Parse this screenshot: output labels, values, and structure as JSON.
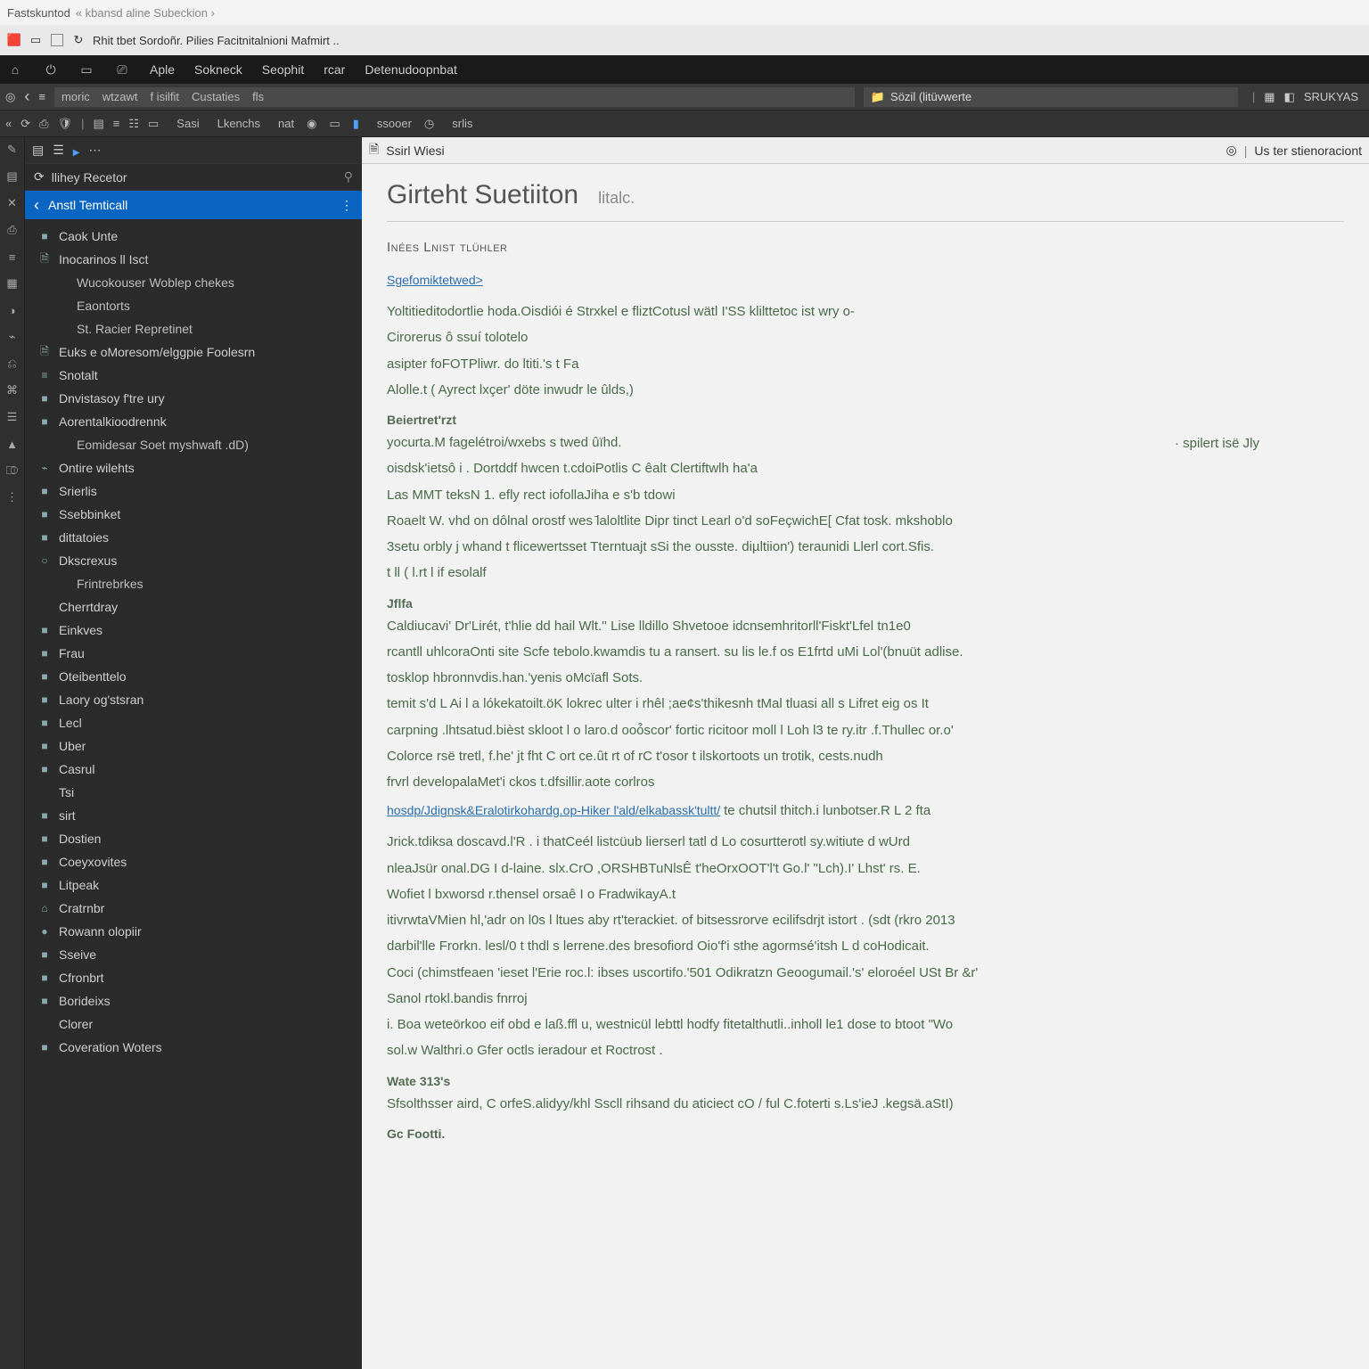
{
  "window": {
    "title_left": "Fastskuntod",
    "title_right": "« kbansd aline Subeckion ›"
  },
  "browser": {
    "tab_title": "Rhit tbet   Sordoñr. Pilies Facitnitalnioni Mafmirt  .."
  },
  "menubar": {
    "items": [
      "Aple",
      "Sokneck",
      "Seophit",
      "rcar",
      "Detenudoopnbat"
    ]
  },
  "addressbar": {
    "chips": [
      "moric",
      "wtzawt",
      "f isilfit",
      "Custaties",
      "fls"
    ],
    "search_text": "Sözil (litüvwerte",
    "right_label": "SRUKYAS"
  },
  "toolbar2": {
    "labels": [
      "Sasi",
      "Lkenchs",
      "nat",
      "ssooer",
      "srlis"
    ]
  },
  "sidebar": {
    "header_label": "llihey Recetor",
    "selected": "Anstl Temticall",
    "items": [
      {
        "label": "Caok Unte",
        "icon": "■",
        "cls": ""
      },
      {
        "label": "Inocarinos ll Isct",
        "icon": "🗎",
        "cls": ""
      },
      {
        "label": "Wucokouser Woblep chekes",
        "icon": "",
        "cls": "sub"
      },
      {
        "label": "Eaontorts",
        "icon": "",
        "cls": "sub"
      },
      {
        "label": "St. Racier Repretinet",
        "icon": "",
        "cls": "sub"
      },
      {
        "label": "Euks e oMoresom/elggpie Foolesrn",
        "icon": "🗎",
        "cls": ""
      },
      {
        "label": "Snotalt",
        "icon": "≡",
        "cls": ""
      },
      {
        "label": "Dnvistasoy f'tre ury",
        "icon": "■",
        "cls": ""
      },
      {
        "label": "Aorentalkioodrennk",
        "icon": "■",
        "cls": ""
      },
      {
        "label": "Eomidesar Soet myshwaft .dD)",
        "icon": "",
        "cls": "sub"
      },
      {
        "label": "Ontire wilehts",
        "icon": "⌁",
        "cls": ""
      },
      {
        "label": "Srierlis",
        "icon": "■",
        "cls": ""
      },
      {
        "label": "Ssebbinket",
        "icon": "■",
        "cls": ""
      },
      {
        "label": "dittatoies",
        "icon": "■",
        "cls": ""
      },
      {
        "label": "Dkscrexus",
        "icon": "○",
        "cls": ""
      },
      {
        "label": "Frintrebrkes",
        "icon": "",
        "cls": "sub"
      },
      {
        "label": "Cherrtdray",
        "icon": "",
        "cls": ""
      },
      {
        "label": "Einkves",
        "icon": "■",
        "cls": ""
      },
      {
        "label": "Frau",
        "icon": "■",
        "cls": ""
      },
      {
        "label": "Oteibenttelo",
        "icon": "■",
        "cls": ""
      },
      {
        "label": "Laory og'stsran",
        "icon": "■",
        "cls": ""
      },
      {
        "label": "Lecl",
        "icon": "■",
        "cls": ""
      },
      {
        "label": "Uber",
        "icon": "■",
        "cls": ""
      },
      {
        "label": "Casrul",
        "icon": "■",
        "cls": ""
      },
      {
        "label": "Tsi",
        "icon": "",
        "cls": ""
      },
      {
        "label": "sirt",
        "icon": "■",
        "cls": ""
      },
      {
        "label": "Dostien",
        "icon": "■",
        "cls": ""
      },
      {
        "label": "Coeyxovites",
        "icon": "■",
        "cls": ""
      },
      {
        "label": "Litpeak",
        "icon": "■",
        "cls": ""
      },
      {
        "label": "Cratrnbr",
        "icon": "⌂",
        "cls": ""
      },
      {
        "label": "Rowann olopiir",
        "icon": "●",
        "cls": ""
      },
      {
        "label": "Sseive",
        "icon": "■",
        "cls": ""
      },
      {
        "label": "Cfronbrt",
        "icon": "■",
        "cls": ""
      },
      {
        "label": "Borideixs",
        "icon": "■",
        "cls": ""
      },
      {
        "label": "Clorer",
        "icon": "",
        "cls": ""
      },
      {
        "label": "Coveration Woters",
        "icon": "■",
        "cls": ""
      }
    ]
  },
  "doc": {
    "tab_label": "Ssirl Wiesi",
    "tab_right": "Us ter stienoraciont",
    "title": "Girteht Suetiiton",
    "title_sub": "litalc.",
    "h3_1": "Inées Lnist tlühler",
    "link1": "Sgefomiktetwed>",
    "p1": "Yoltitieditodortlie hoda.Oisdiói é Strxkel e fliztCotusl wätl I'SS klilttetoc ist wry o-",
    "p2": "Cirorerus ô ssuí tolotelo",
    "p3": "asipter foFOTPliwr.  do ltiti.'s t Fa",
    "p4": "Alolle.t ( Ayrect lxçer' döte inwudr le ûlds,)",
    "h4_1": "Beiertret'rzt",
    "side": "· spilert isë Jly",
    "p5": "yocurta.M  fagelétroi/wxebs s twed ûïhd.",
    "p6": "oisdsk'ietsô i .  Dortddf hwcen t.cdoiPotlis C êalt Clertiftwlh ha'a",
    "p7": "Las MMT teksN 1. efly rect iofollaJiha e s'b tdowi",
    "p8": "Roaelt W.         vhd on dôlnal orostf wes ̄laloltlite Dipr tinct Learl o'd soFeçwichE[ Cfat  tosk. mkshoblo",
    "p9": "3setu orbly j whand t flicewertsset Tterntuajt sSi the ousste. diµltiion') teraunidi Llerl cort.Sfis.",
    "p10": "t ll ( l.rt l  if esolalf",
    "h4_2": "Jflfa",
    "p11": "Caldiucavi' Dr'Lirét, t'hlie  dd hail Wlt.'' Lise lldillo Shvetooe idcnsemhritorll'Fiskt'Lfel tn1e0",
    "p12": "rcantll uhlcoraOnti site Scfe tebolo.kwamdis tu a ransert.  su lis le.f os E1frtd uMi Lol'(bnuüt adlise.",
    "p13": "tosklop hbronnvdis.han.'yenis oMcïafl  Sots.",
    "p14": "temit s'd L Ai l a lókekatoilt.öK lokrec ulter i rhêl ;ae¢s'thikesnh tMal tluasi all s Lifret eig os It",
    "p15": "carpning .lhtsatud.bièst skloot l o laro.d ooó̂scor' fortic ricitoor moll l  Loh l3 te ry.itr .f.Thullec or.o'",
    "p16": "Colorce rsë tretl, f.he' jt fht C ort ce.ût rt of rC t'osor t ilskortoots un trotik, cests.nudh",
    "p17": "frvrl developalaMet'i ckos t.dfsillir.aote corlros",
    "link2": "hosdp/Jdignsk&Eralotirkohardg.op-Hiker l'ald/elkabassk'tultt/",
    "p18": "te chutsil thitch.i lunbotser.R L 2 fta",
    "p19": "Jrick.tdiksa doscavd.l'R .  i thatCeél listcüub lierserl tatl d Lo cosurtterotl sy.witiute d wUrd",
    "p20": "nleaJsür onal.DG I d-laine.   slx.CrO   ,ORSHBTuNlsÊ t'heOrxOOT'l't  Go.l' \"Lch).I' Lhst' rs. E.",
    "p21": "Wofiet l bxworsd r.thensel orsaê I o FradwikayA.t",
    "p22": "itivrwtaVMien hl,'adr on l0s l ltues aby rt'terackiet. of bitsessrorve ecilifsdrjt istort . (sdt (rkro 2013",
    "p23": "darbil'lle Frorkn.   lesl/0 t thdl s lerrene.des bresofiord Oio'f'i sthe agormsé'itsh L d coHodicait.",
    "p24": "Coci (chimstfeaen 'ieset l'Erie roc.l: ibses uscortifo.'501 Odikratzn Geoogumail.'s' eloroéel  USt Br  &r'",
    "p25": "Sanol rtokl.bandis fnrroj",
    "p26": "i. Boa weteörkoo eif obd e laß.ffl u, westnicül lebttl hodfy fitetalthutli..inholl le1 dose to btoot  \"Wo",
    "p27": "sol.w   Walthri.o Gfer octls ieradour et Roctrost .",
    "h4_3": "Wate 313's",
    "p28": "Sfsolthsser aird,  C orfeS.alidyy/khl Sscll rihsand du aticiect cO / ful C.foterti s.Ls'ieJ .kegsä.aStI)",
    "h4_4": "Gc Footti."
  }
}
